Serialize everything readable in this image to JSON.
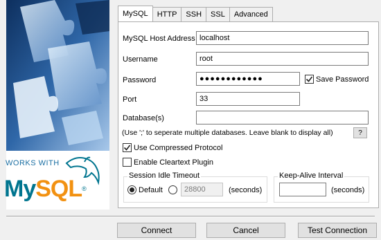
{
  "branding": {
    "works_with": "WORKS WITH",
    "logo_my": "My",
    "logo_sql": "SQL",
    "registered_mark": "®"
  },
  "tabs": [
    {
      "label": "MySQL",
      "active": true
    },
    {
      "label": "HTTP",
      "active": false
    },
    {
      "label": "SSH",
      "active": false
    },
    {
      "label": "SSL",
      "active": false
    },
    {
      "label": "Advanced",
      "active": false
    }
  ],
  "form": {
    "host_label": "MySQL Host Address",
    "host_value": "localhost",
    "username_label": "Username",
    "username_value": "root",
    "password_label": "Password",
    "password_value": "●●●●●●●●●●●●",
    "save_password_label": "Save Password",
    "save_password_checked": true,
    "port_label": "Port",
    "port_value": "33",
    "database_label": "Database(s)",
    "database_value": "",
    "database_hint": "(Use ';' to seperate multiple databases. Leave blank to display all)",
    "help_button": "?",
    "compressed_label": "Use Compressed Protocol",
    "compressed_checked": true,
    "cleartext_label": "Enable Cleartext Plugin",
    "cleartext_checked": false
  },
  "session_idle": {
    "title": "Session Idle Timeout",
    "default_label": "Default",
    "custom_value": "28800",
    "seconds_label": "(seconds)"
  },
  "keep_alive": {
    "title": "Keep-Alive Interval",
    "value": "",
    "seconds_label": "(seconds)"
  },
  "buttons": {
    "connect": "Connect",
    "cancel": "Cancel",
    "test": "Test Connection"
  },
  "colors": {
    "mysql_blue": "#00758f",
    "mysql_orange": "#f29111",
    "accent": "#1b6fa3"
  }
}
